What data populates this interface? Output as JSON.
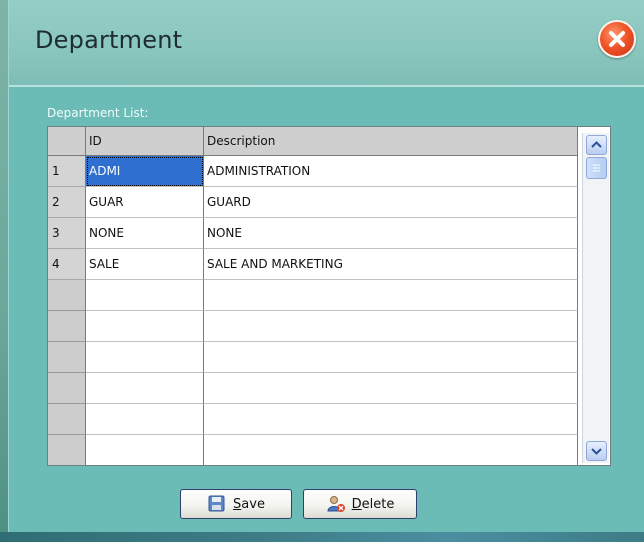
{
  "window": {
    "title": "Department"
  },
  "list_label": "Department List:",
  "grid": {
    "columns": [
      "ID",
      "Description"
    ],
    "rows": [
      {
        "num": "1",
        "id": "ADMI",
        "description": "ADMINISTRATION"
      },
      {
        "num": "2",
        "id": "GUAR",
        "description": "GUARD"
      },
      {
        "num": "3",
        "id": "NONE",
        "description": "NONE"
      },
      {
        "num": "4",
        "id": "SALE",
        "description": "SALE AND MARKETING"
      }
    ]
  },
  "buttons": {
    "save": {
      "accel": "S",
      "rest": "ave"
    },
    "delete": {
      "accel": "D",
      "rest": "elete"
    }
  },
  "icons": {
    "close": "close-icon",
    "save": "floppy-disk-icon",
    "delete": "user-delete-icon",
    "scroll_up": "chevron-up-icon",
    "scroll_down": "chevron-down-icon"
  },
  "colors": {
    "window_bg": "#6bbcb6",
    "selection": "#2f6fd0",
    "close_red": "#f0542a"
  }
}
